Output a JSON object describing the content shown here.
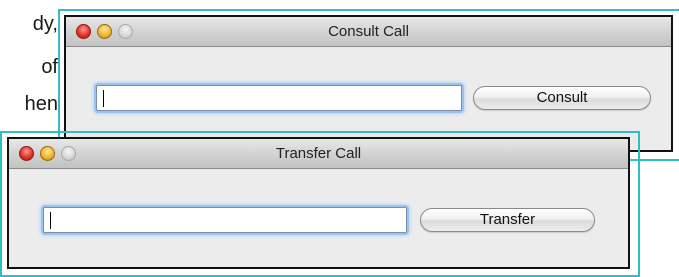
{
  "background_text": {
    "line1": "dy,",
    "line2": "of",
    "line3": "hen"
  },
  "colors": {
    "highlight_frame": "#2dbfc5",
    "window_background": "#ececec",
    "focus_ring": "#9cc3ee"
  },
  "consult_dialog": {
    "title": "Consult Call",
    "input_value": "",
    "button_label": "Consult"
  },
  "transfer_dialog": {
    "title": "Transfer Call",
    "input_value": "",
    "button_label": "Transfer"
  }
}
